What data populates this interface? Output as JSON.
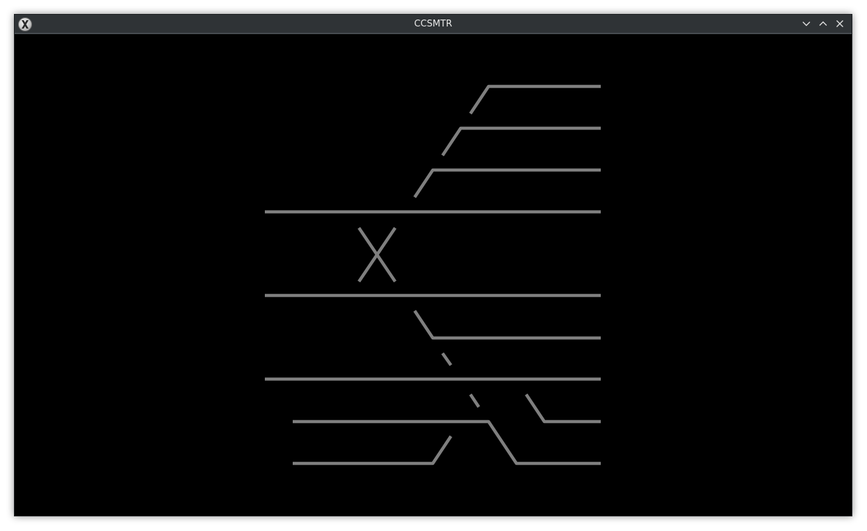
{
  "window": {
    "title": "CCSMTR",
    "icon": "x-app-icon",
    "controls": [
      "minimize-icon",
      "maximize-icon",
      "close-icon"
    ]
  },
  "colors": {
    "background": "#000000",
    "track": "#7f7f7f",
    "titlebar": "#2f3336",
    "title_text": "#e6e6e6"
  }
}
